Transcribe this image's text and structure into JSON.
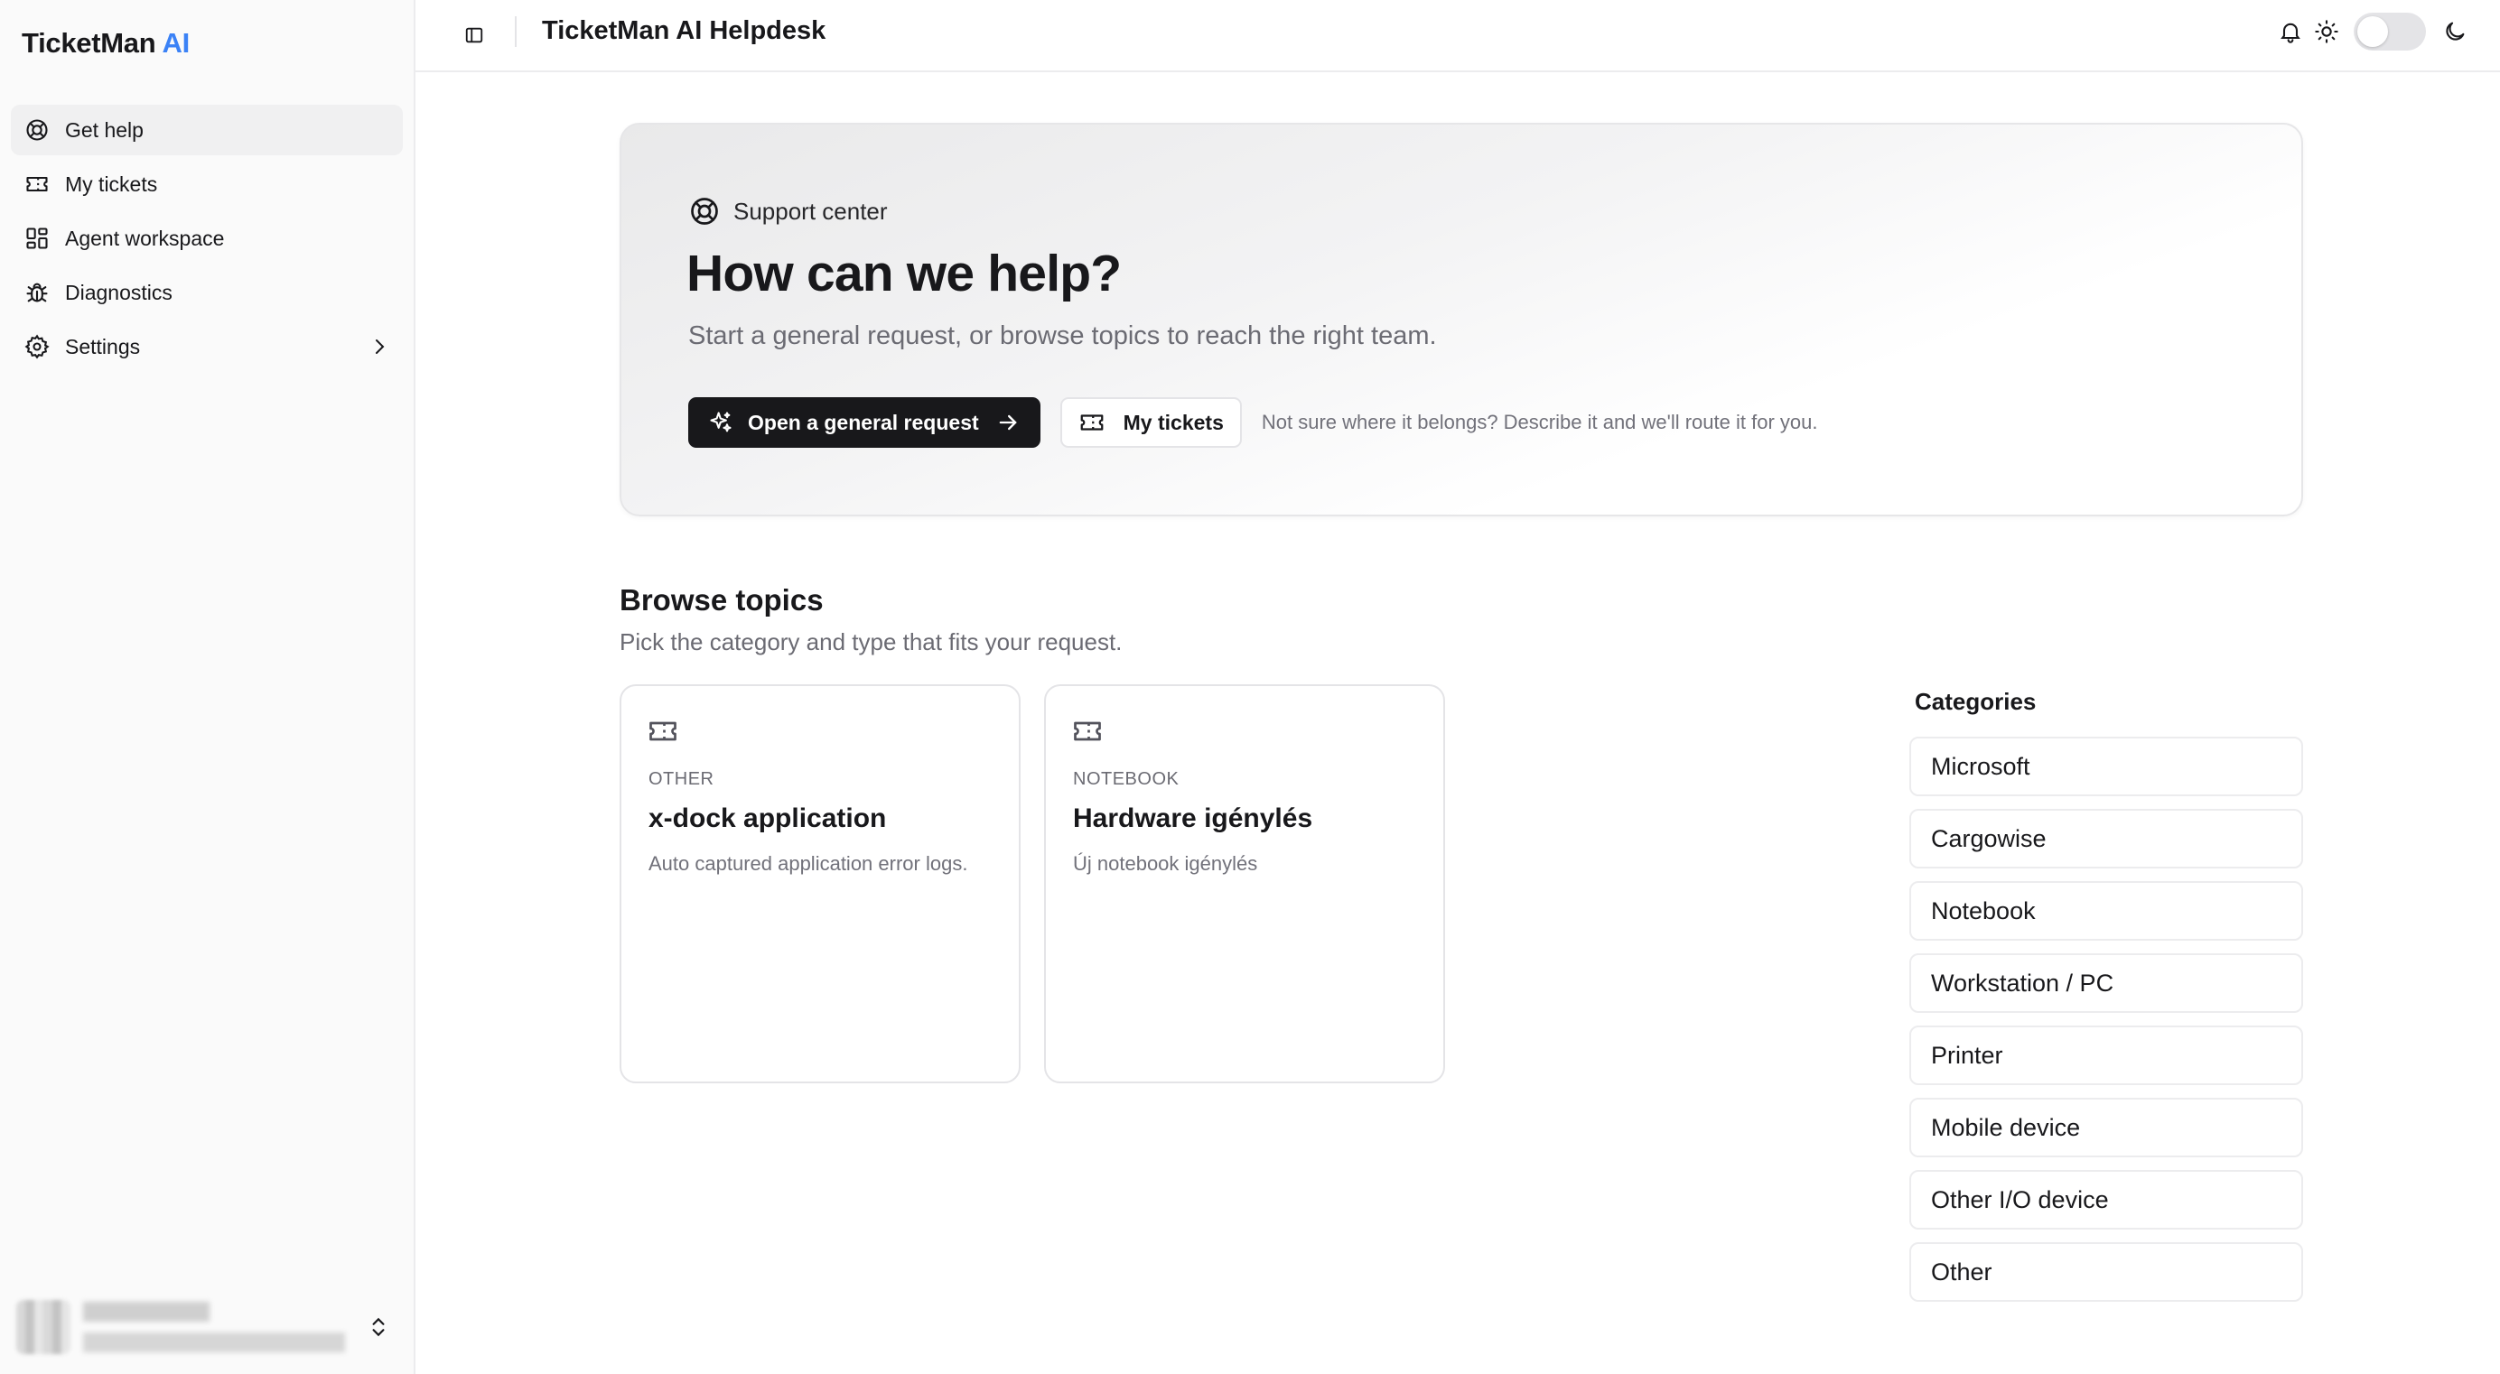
{
  "sidebar": {
    "brand_name": "TicketMan",
    "brand_accent": "AI",
    "accent_color": "#3b82f6",
    "items": [
      {
        "label": "Get help",
        "icon": "lifebuoy-icon",
        "active": true
      },
      {
        "label": "My tickets",
        "icon": "ticket-icon"
      },
      {
        "label": "Agent workspace",
        "icon": "dashboard-icon"
      },
      {
        "label": "Diagnostics",
        "icon": "bug-icon"
      },
      {
        "label": "Settings",
        "icon": "gear-icon",
        "has_submenu": true
      }
    ]
  },
  "topbar": {
    "title": "TicketMan AI Helpdesk",
    "theme_toggle_on": false
  },
  "hero": {
    "label": "Support center",
    "title": "How can we help?",
    "subtitle": "Start a general request, or browse topics to reach the right team.",
    "primary_button": "Open a general request",
    "secondary_button": "My tickets",
    "hint": "Not sure where it belongs? Describe it and we'll route it for you."
  },
  "browse": {
    "title": "Browse topics",
    "subtitle": "Pick the category and type that fits your request.",
    "cards": [
      {
        "category": "OTHER",
        "title": "x-dock application",
        "description": "Auto captured application error logs."
      },
      {
        "category": "NOTEBOOK",
        "title": "Hardware igénylés",
        "description": "Új notebook igénylés"
      }
    ]
  },
  "categories": {
    "title": "Categories",
    "items": [
      "Microsoft",
      "Cargowise",
      "Notebook",
      "Workstation / PC",
      "Printer",
      "Mobile device",
      "Other I/O device",
      "Other"
    ]
  }
}
